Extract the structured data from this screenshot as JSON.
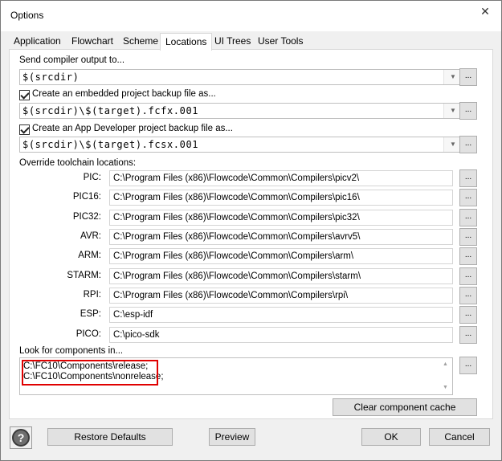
{
  "window": {
    "title": "Options",
    "close_glyph": "✕"
  },
  "tabs": [
    {
      "label": "Application"
    },
    {
      "label": "Flowchart"
    },
    {
      "label": "Scheme"
    },
    {
      "label": "Locations",
      "active": true
    },
    {
      "label": "UI Trees"
    },
    {
      "label": "User Tools"
    }
  ],
  "compiler_output": {
    "label": "Send compiler output to...",
    "value": "$(srcdir)"
  },
  "embedded_backup": {
    "label": "Create an embedded project backup file as...",
    "checked": true,
    "value": "$(srcdir)\\$(target).fcfx.001"
  },
  "appdev_backup": {
    "label": "Create an App Developer project backup file as...",
    "checked": true,
    "value": "$(srcdir)\\$(target).fcsx.001"
  },
  "toolchain": {
    "label": "Override toolchain locations:",
    "items": [
      {
        "name": "PIC:",
        "path": "C:\\Program Files (x86)\\Flowcode\\Common\\Compilers\\picv2\\"
      },
      {
        "name": "PIC16:",
        "path": "C:\\Program Files (x86)\\Flowcode\\Common\\Compilers\\pic16\\"
      },
      {
        "name": "PIC32:",
        "path": "C:\\Program Files (x86)\\Flowcode\\Common\\Compilers\\pic32\\"
      },
      {
        "name": "AVR:",
        "path": "C:\\Program Files (x86)\\Flowcode\\Common\\Compilers\\avrv5\\"
      },
      {
        "name": "ARM:",
        "path": "C:\\Program Files (x86)\\Flowcode\\Common\\Compilers\\arm\\"
      },
      {
        "name": "STARM:",
        "path": "C:\\Program Files (x86)\\Flowcode\\Common\\Compilers\\starm\\"
      },
      {
        "name": "RPI:",
        "path": "C:\\Program Files (x86)\\Flowcode\\Common\\Compilers\\rpi\\"
      },
      {
        "name": "ESP:",
        "path": "C:\\esp-idf"
      },
      {
        "name": "PICO:",
        "path": "C:\\pico-sdk"
      }
    ]
  },
  "components": {
    "label": "Look for components in...",
    "lines": [
      "C:\\FC10\\Components\\release;",
      "C:\\FC10\\Components\\nonrelease;"
    ],
    "highlight_color": "#e00000"
  },
  "browse_label": "...",
  "clear_cache_label": "Clear component cache",
  "footer": {
    "help_glyph": "?",
    "restore_label": "Restore Defaults",
    "preview_label": "Preview",
    "ok_label": "OK",
    "cancel_label": "Cancel"
  }
}
